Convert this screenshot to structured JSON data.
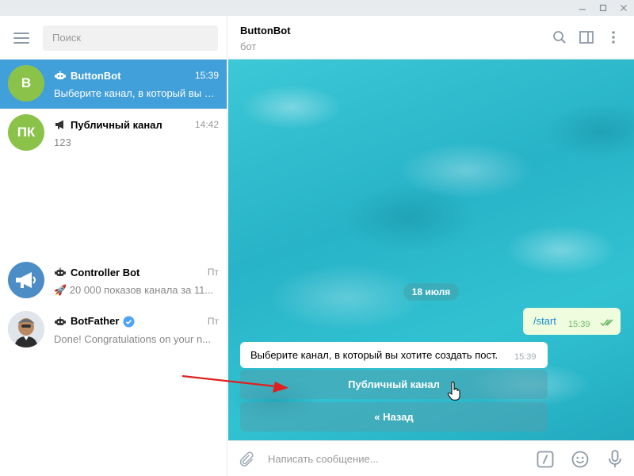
{
  "window": {
    "controls": [
      "minimize-icon",
      "maximize-icon",
      "close-icon"
    ]
  },
  "sidebar": {
    "search_placeholder": "Поиск",
    "chats": [
      {
        "avatar_text": "B",
        "avatar_color": "#8bc34a",
        "type_icon": "bot-icon",
        "name": "ButtonBot",
        "time": "15:39",
        "preview": "Выберите канал, в который вы хотите создать пост.",
        "active": true
      },
      {
        "avatar_text": "ПК",
        "avatar_color": "#8bc34a",
        "type_icon": "megaphone-icon",
        "name": "Публичный канал",
        "time": "14:42",
        "preview": "123"
      },
      {
        "avatar_icon": "megaphone-avatar-icon",
        "avatar_color": "#4d8dc5",
        "type_icon": "bot-icon",
        "name": "Controller Bot",
        "time": "Пт",
        "preview_icon": "🚀",
        "preview": "20 000 показов канала за 11..."
      },
      {
        "avatar_icon": "botfather-avatar-icon",
        "type_icon": "bot-icon",
        "name": "BotFather",
        "verified": true,
        "time": "Пт",
        "preview": "Done! Congratulations on your n..."
      }
    ]
  },
  "chat": {
    "title": "ButtonBot",
    "subtitle": "бот",
    "date_separator": "18 июля",
    "outgoing": {
      "text": "/start",
      "time": "15:39"
    },
    "incoming": {
      "text": "Выберите канал, в который вы хотите создать пост.",
      "time": "15:39"
    },
    "keyboard": [
      "Публичный канал",
      "« Назад"
    ],
    "composer_placeholder": "Написать сообщение..."
  },
  "colors": {
    "accent": "#419fd9",
    "outgoing_bubble": "#effdde",
    "annotation_arrow": "#e02020"
  }
}
